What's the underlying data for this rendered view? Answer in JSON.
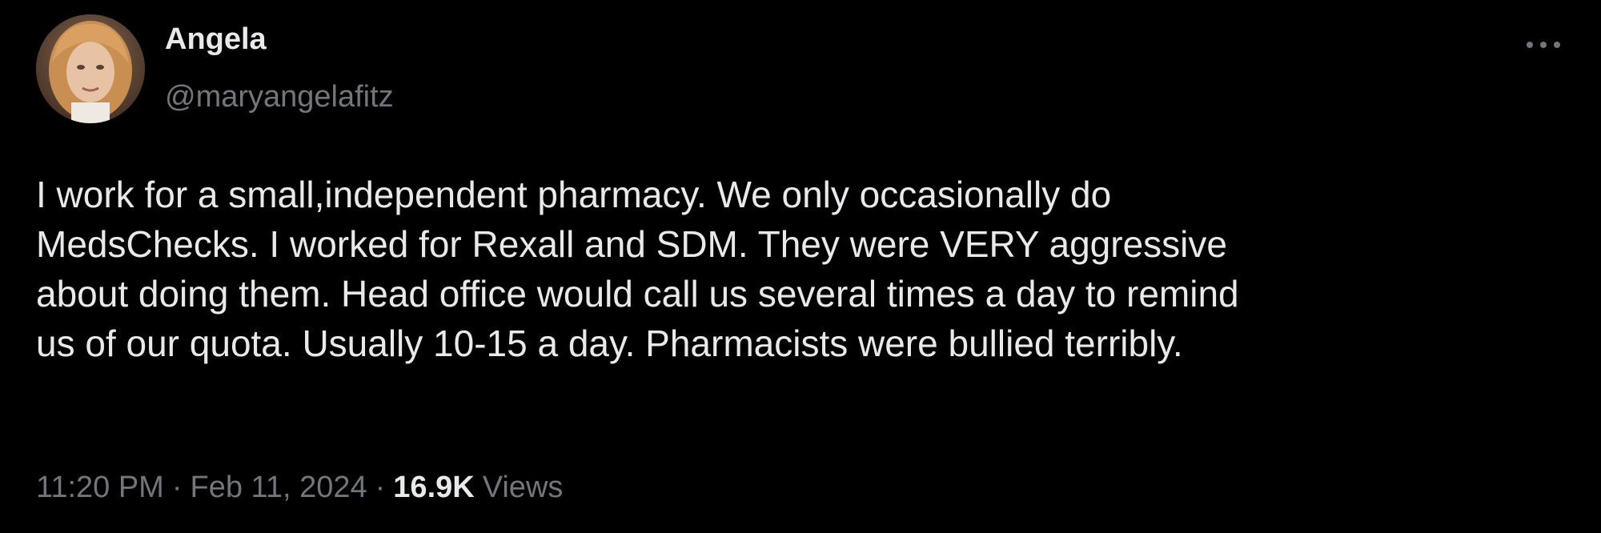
{
  "author": {
    "name": "Angela",
    "handle": "@maryangelafitz"
  },
  "icons": {
    "avatar": "profile-photo",
    "more": "more-horizontal-icon"
  },
  "tweet": {
    "lines": [
      "I work for a small,independent pharmacy. We only occasionally do",
      "MedsChecks. I worked for Rexall and SDM. They were VERY aggressive",
      "about doing them. Head office would call us several times a day to remind",
      "us of our quota. Usually 10-15 a day. Pharmacists were bullied terribly."
    ]
  },
  "meta": {
    "time": "11:20 PM",
    "separator": "·",
    "date": "Feb 11, 2024",
    "views_count": "16.9K",
    "views_label": "Views"
  },
  "colors": {
    "background": "#000000",
    "primary_text": "#e7e9ea",
    "secondary_text": "#71767b"
  }
}
